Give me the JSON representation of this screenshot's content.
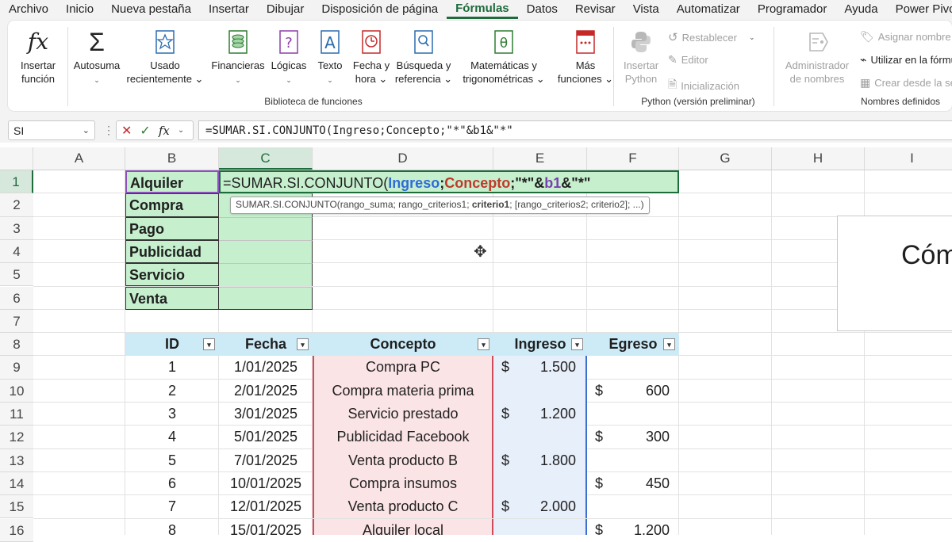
{
  "menu": {
    "tabs": [
      "Archivo",
      "Inicio",
      "Nueva pestaña",
      "Insertar",
      "Dibujar",
      "Disposición de página",
      "Fórmulas",
      "Datos",
      "Revisar",
      "Vista",
      "Automatizar",
      "Programador",
      "Ayuda",
      "Power Pivot"
    ],
    "active_tab": "Fórmulas",
    "accent_color": "#1e6b3c"
  },
  "ribbon": {
    "insert_function": {
      "line1": "Insertar",
      "line2": "función",
      "icon": "fx-icon"
    },
    "autosum": {
      "line1": "Autosuma",
      "line2": "⌄",
      "icon": "sigma-icon"
    },
    "recent": {
      "line1": "Usado",
      "line2": "recientemente ⌄",
      "icon": "star-book-icon"
    },
    "financial": {
      "line1": "Financieras",
      "line2": "⌄",
      "icon": "coins-book-icon"
    },
    "logical": {
      "line1": "Lógicas",
      "line2": "⌄",
      "icon": "question-book-icon"
    },
    "text": {
      "line1": "Texto",
      "line2": "⌄",
      "icon": "letter-a-book-icon"
    },
    "datetime": {
      "line1": "Fecha y",
      "line2": "hora ⌄",
      "icon": "clock-book-icon"
    },
    "lookup": {
      "line1": "Búsqueda y",
      "line2": "referencia ⌄",
      "icon": "magnifier-book-icon"
    },
    "math": {
      "line1": "Matemáticas y",
      "line2": "trigonométricas ⌄",
      "icon": "theta-book-icon"
    },
    "more": {
      "line1": "Más",
      "line2": "funciones ⌄",
      "icon": "dots-book-icon"
    },
    "library_label": "Biblioteca de funciones",
    "python": {
      "insert": {
        "line1": "Insertar",
        "line2": "Python",
        "icon": "python-icon"
      },
      "reset": "Restablecer",
      "editor": "Editor",
      "init": "Inicialización",
      "label": "Python (versión preliminar)"
    },
    "names": {
      "manager": {
        "line1": "Administrador",
        "line2": "de nombres",
        "icon": "name-manager-icon"
      },
      "assign": "Asignar nombre",
      "use_in_formula": "Utilizar en la fórmula",
      "create_from_selection": "Crear desde la selección",
      "label": "Nombres definidos"
    }
  },
  "formula_bar": {
    "name_box": "SI",
    "formula": "=SUMAR.SI.CONJUNTO(Ingreso;Concepto;\"*\"&b1&\"*\""
  },
  "grid": {
    "columns": [
      "A",
      "B",
      "C",
      "D",
      "E",
      "F",
      "G",
      "H",
      "I"
    ],
    "rows": [
      "1",
      "2",
      "3",
      "4",
      "5",
      "6",
      "7",
      "8",
      "9",
      "10",
      "11",
      "12",
      "13",
      "14",
      "15",
      "16"
    ],
    "active_column": "C",
    "active_row": "1",
    "criteria_labels": [
      "Alquiler",
      "Compra",
      "Pago",
      "Publicidad",
      "Servicio",
      "Venta"
    ],
    "editing": {
      "prefix": "=SUMAR.SI.CONJUNTO(",
      "ref1": "Ingreso",
      "sep1": ";",
      "ref2": "Concepto",
      "sep2": ";\"*\"&",
      "ref3": "b1",
      "suffix": "&\"*\"",
      "ref1_color": "#2f6bd8",
      "ref2_color": "#c0392b",
      "ref3_color": "#7b3fb0"
    },
    "tooltip": {
      "before": "SUMAR.SI.CONJUNTO(rango_suma; rango_criterios1; ",
      "bold": "criterio1",
      "after": "; [rango_criterios2; criterio2]; ...)"
    },
    "table_headers": [
      "ID",
      "Fecha",
      "Concepto",
      "Ingreso",
      "Egreso"
    ],
    "table_rows": [
      {
        "id": "1",
        "fecha": "1/01/2025",
        "concepto": "Compra PC",
        "ingreso": "1.500",
        "egreso": ""
      },
      {
        "id": "2",
        "fecha": "2/01/2025",
        "concepto": "Compra materia prima",
        "ingreso": "",
        "egreso": "600"
      },
      {
        "id": "3",
        "fecha": "3/01/2025",
        "concepto": "Servicio prestado",
        "ingreso": "1.200",
        "egreso": ""
      },
      {
        "id": "4",
        "fecha": "5/01/2025",
        "concepto": "Publicidad Facebook",
        "ingreso": "",
        "egreso": "300"
      },
      {
        "id": "5",
        "fecha": "7/01/2025",
        "concepto": "Venta producto B",
        "ingreso": "1.800",
        "egreso": ""
      },
      {
        "id": "6",
        "fecha": "10/01/2025",
        "concepto": "Compra insumos",
        "ingreso": "",
        "egreso": "450"
      },
      {
        "id": "7",
        "fecha": "12/01/2025",
        "concepto": "Venta producto C",
        "ingreso": "2.000",
        "egreso": ""
      },
      {
        "id": "8",
        "fecha": "15/01/2025",
        "concepto": "Alquiler local",
        "ingreso": "",
        "egreso": "1.200"
      }
    ],
    "currency_symbol": "$"
  },
  "overlay": {
    "text": "Cóm"
  }
}
